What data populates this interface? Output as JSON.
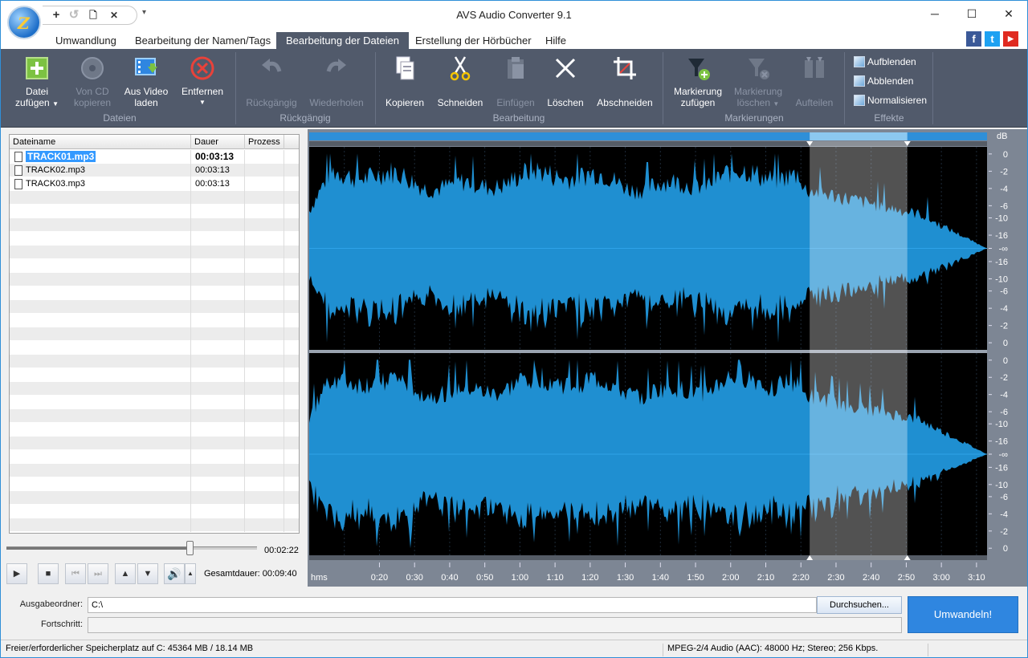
{
  "window": {
    "title": "AVS Audio Converter  9.1",
    "min_glyph": "─",
    "max_glyph": "☐",
    "close_glyph": "✕"
  },
  "quick_access": {
    "add": "+",
    "undo": "↺",
    "save": "🗋",
    "close": "✕",
    "more": "▾"
  },
  "menu_tabs": [
    {
      "label": "Umwandlung"
    },
    {
      "label": "Bearbeitung der Namen/Tags"
    },
    {
      "label": "Bearbeitung der Dateien"
    },
    {
      "label": "Erstellung der Hörbücher"
    },
    {
      "label": "Hilfe"
    }
  ],
  "active_tab": "Bearbeitung der Dateien",
  "social": {
    "facebook": "f",
    "twitter": "t",
    "youtube": "▶"
  },
  "ribbon": {
    "groups": {
      "dateien": "Dateien",
      "rueckgaengig": "Rückgängig",
      "bearbeitung": "Bearbeitung",
      "markierungen": "Markierungen",
      "effekte": "Effekte"
    },
    "buttons": {
      "datei_zufuegen": [
        "Datei",
        "zufügen"
      ],
      "von_cd": [
        "Von CD",
        "kopieren"
      ],
      "aus_video": [
        "Aus Video",
        "laden"
      ],
      "entfernen": [
        "Entfernen",
        ""
      ],
      "rueckgaengig": "Rückgängig",
      "wiederholen": "Wiederholen",
      "kopieren": "Kopieren",
      "schneiden": "Schneiden",
      "einfuegen": "Einfügen",
      "loeschen": "Löschen",
      "abschneiden": "Abschneiden",
      "markierung_zufuegen": [
        "Markierung",
        "zufügen"
      ],
      "markierung_loeschen": [
        "Markierung",
        "löschen"
      ],
      "aufteilen": "Aufteilen"
    },
    "effects": [
      "Aufblenden",
      "Abblenden",
      "Normalisieren"
    ]
  },
  "file_list": {
    "headers": {
      "name": "Dateiname",
      "duration": "Dauer",
      "progress": "Prozess"
    },
    "rows": [
      {
        "name": "TRACK01.mp3",
        "duration": "00:03:13",
        "selected": true
      },
      {
        "name": "TRACK02.mp3",
        "duration": "00:03:13",
        "selected": false
      },
      {
        "name": "TRACK03.mp3",
        "duration": "00:03:13",
        "selected": false
      }
    ]
  },
  "player": {
    "position": "00:02:22",
    "position_fraction": 0.73,
    "total_label": "Gesamtdauer:",
    "total_value": "00:09:40"
  },
  "waveform": {
    "unit": "dB",
    "db_ticks": [
      "0",
      "-2",
      "-4",
      "-6",
      "-10",
      "-16",
      "-∞",
      "-16",
      "-10",
      "-6",
      "-4",
      "-2",
      "0"
    ],
    "time_unit": "hms",
    "time_ticks": [
      "0:20",
      "0:30",
      "0:40",
      "0:50",
      "1:00",
      "1:10",
      "1:20",
      "1:30",
      "1:40",
      "1:50",
      "2:00",
      "2:10",
      "2:20",
      "2:30",
      "2:40",
      "2:50",
      "3:00",
      "3:10"
    ],
    "duration_seconds": 193,
    "selection_seconds": [
      142.5,
      170.3
    ],
    "wave_color": "#1f8fd1",
    "selection_color": "#5ab0e6"
  },
  "output": {
    "folder_label": "Ausgabeordner:",
    "folder_value": "C:\\",
    "browse_label": "Durchsuchen...",
    "progress_label": "Fortschritt:",
    "convert_label": "Umwandeln!"
  },
  "status": {
    "space": "Freier/erforderlicher Speicherplatz auf C: 45364 MB / 18.14 MB",
    "format": "MPEG-2/4 Audio (AAC): 48000  Hz; Stereo; 256 Kbps."
  }
}
